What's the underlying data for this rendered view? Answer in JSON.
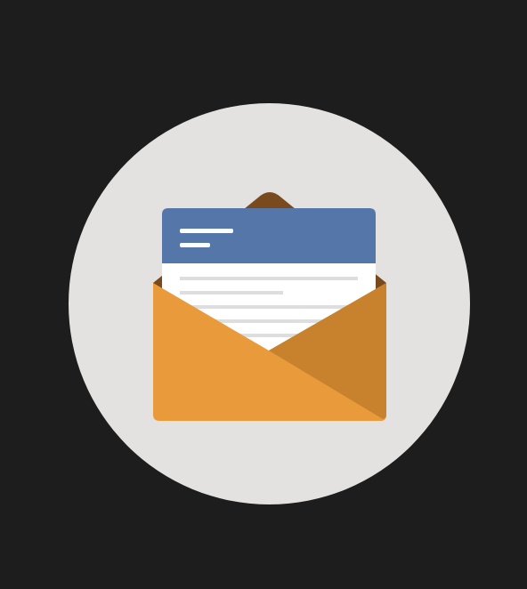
{
  "colors": {
    "background": "#1d1d1d",
    "circle": "#e3e2e0",
    "envelope_back": "#7a4a1f",
    "envelope_front": "#e99b3c",
    "envelope_shadow": "#c8822e",
    "letter_header": "#5576a8",
    "letter_body": "#ffffff",
    "letter_lines": "#d9d9d9"
  },
  "icon": {
    "name": "open-envelope-icon"
  }
}
